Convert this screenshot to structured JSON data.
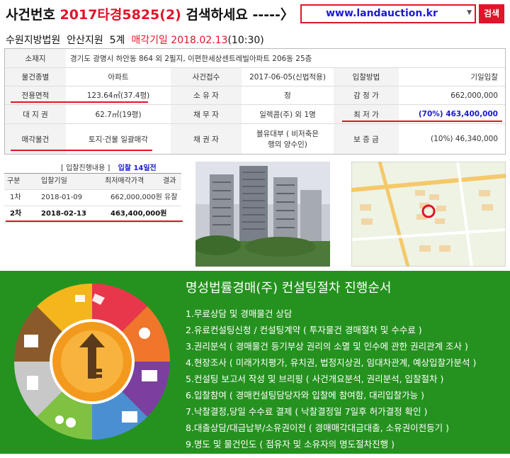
{
  "header": {
    "prefix": "사건번호",
    "case_number": "2017타경5825(2)",
    "suffix": "검색하세요 -----〉",
    "search_value": "www.landauction.kr",
    "search_button": "검색"
  },
  "court": {
    "name": "수원지방법원",
    "branch": "안산지원",
    "dept": "5계",
    "sale_date": "매각기일 2018.02.13",
    "sale_time": "(10:30)"
  },
  "info": {
    "address_label": "소재지",
    "address_value": "경기도 광명시 하안동 864 외 2필지, 이편한세상센트레빌아파트 206동 25층",
    "type_label": "물건종별",
    "type_value": "아파트",
    "accept_label": "사건접수",
    "accept_value": "2017-06-05(신법적용)",
    "bidmethod_label": "입찰방법",
    "bidmethod_value": "기일입찰",
    "area_label": "전용면적",
    "area_value": "123.64㎡(37.4평)",
    "owner_label": "소 유 자",
    "owner_value": "정",
    "appraisal_label": "감 정 가",
    "appraisal_value": "662,000,000",
    "land_label": "대 지 권",
    "land_value": "62.7㎡(19평)",
    "debtor_label": "채 무 자",
    "debtor_value": "일렉콤(주) 외 1명",
    "minprice_label": "최 저 가",
    "minprice_value": "(70%) 463,400,000",
    "saleitem_label": "매각물건",
    "saleitem_value": "토지·건물 일괄매각",
    "creditor_label": "채 권 자",
    "creditor_value_1": "블유대부 (        비저축은",
    "creditor_value_2": "행의 양수인)",
    "deposit_label": "보 증 금",
    "deposit_value": "(10%) 46,340,000"
  },
  "bids": {
    "title": "[ 입찰진행내용 ]",
    "days": "입찰 14일전",
    "columns": [
      "구분",
      "입찰기일",
      "최저매각가격",
      "결과"
    ],
    "rows": [
      [
        "1차",
        "2018-01-09",
        "662,000,000원",
        "유찰"
      ],
      [
        "2차",
        "2018-02-13",
        "463,400,000원",
        ""
      ]
    ]
  },
  "consult": {
    "title": "명성법률경매(주) 컨설팅절차 진행순서",
    "steps": [
      "1.무료상담 및 경매물건 상담",
      "2.유료컨설팅신청 / 컨설팅계약 ( 투자물건 경매절차 및 수수료 )",
      "3.권리분석 ( 경매물건 등기부상 권리의 소멸 및 인수에 관한 권리관계 조사 )",
      "4.현장조사 ( 미래가치평가, 유치권, 법정지상권, 임대차관계, 예상입찰가분석 )",
      "5.컨설팅 보고서 작성 및 브리핑 ( 사건개요분석, 권리분석, 입찰절차 )",
      "6.입찰참여 ( 경매컨설팅담당자와 입찰에 참여함, 대리입찰가능 )",
      "7.낙찰결정,당일 수수료 결제 ( 낙찰결정일 7일후 허가결정 확인 )",
      "8.대출상담/대금납부/소유권이전 ( 경매매각대금대출, 소유권이전등기 )",
      "9.명도 및 물건인도 ( 점유자 및 소유자의 명도절차진행 )"
    ]
  },
  "colors": {
    "accent": "#e0152a",
    "link": "#1a1ad0",
    "panel": "#25921f"
  }
}
